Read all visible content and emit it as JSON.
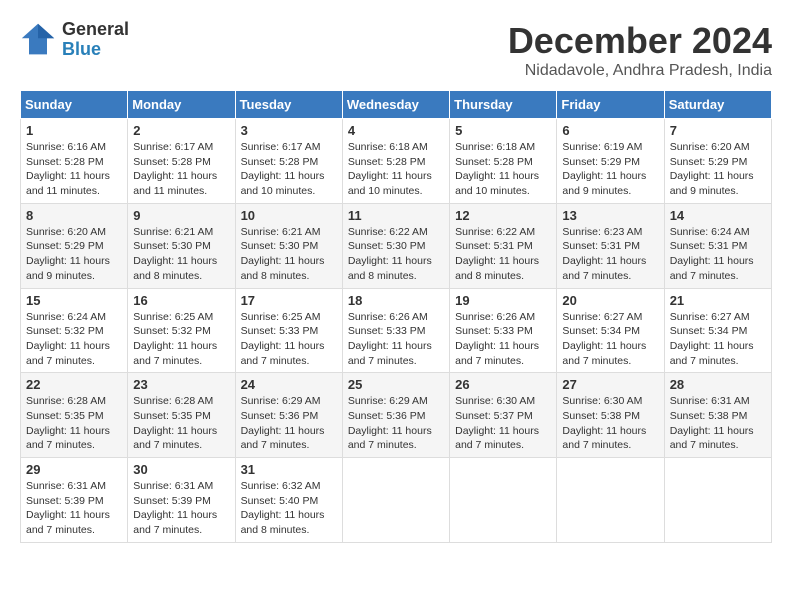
{
  "header": {
    "logo_general": "General",
    "logo_blue": "Blue",
    "month": "December 2024",
    "location": "Nidadavole, Andhra Pradesh, India"
  },
  "days_of_week": [
    "Sunday",
    "Monday",
    "Tuesday",
    "Wednesday",
    "Thursday",
    "Friday",
    "Saturday"
  ],
  "weeks": [
    [
      {
        "day": "1",
        "sunrise": "6:16 AM",
        "sunset": "5:28 PM",
        "daylight": "11 hours and 11 minutes."
      },
      {
        "day": "2",
        "sunrise": "6:17 AM",
        "sunset": "5:28 PM",
        "daylight": "11 hours and 11 minutes."
      },
      {
        "day": "3",
        "sunrise": "6:17 AM",
        "sunset": "5:28 PM",
        "daylight": "11 hours and 10 minutes."
      },
      {
        "day": "4",
        "sunrise": "6:18 AM",
        "sunset": "5:28 PM",
        "daylight": "11 hours and 10 minutes."
      },
      {
        "day": "5",
        "sunrise": "6:18 AM",
        "sunset": "5:28 PM",
        "daylight": "11 hours and 10 minutes."
      },
      {
        "day": "6",
        "sunrise": "6:19 AM",
        "sunset": "5:29 PM",
        "daylight": "11 hours and 9 minutes."
      },
      {
        "day": "7",
        "sunrise": "6:20 AM",
        "sunset": "5:29 PM",
        "daylight": "11 hours and 9 minutes."
      }
    ],
    [
      {
        "day": "8",
        "sunrise": "6:20 AM",
        "sunset": "5:29 PM",
        "daylight": "11 hours and 9 minutes."
      },
      {
        "day": "9",
        "sunrise": "6:21 AM",
        "sunset": "5:30 PM",
        "daylight": "11 hours and 8 minutes."
      },
      {
        "day": "10",
        "sunrise": "6:21 AM",
        "sunset": "5:30 PM",
        "daylight": "11 hours and 8 minutes."
      },
      {
        "day": "11",
        "sunrise": "6:22 AM",
        "sunset": "5:30 PM",
        "daylight": "11 hours and 8 minutes."
      },
      {
        "day": "12",
        "sunrise": "6:22 AM",
        "sunset": "5:31 PM",
        "daylight": "11 hours and 8 minutes."
      },
      {
        "day": "13",
        "sunrise": "6:23 AM",
        "sunset": "5:31 PM",
        "daylight": "11 hours and 7 minutes."
      },
      {
        "day": "14",
        "sunrise": "6:24 AM",
        "sunset": "5:31 PM",
        "daylight": "11 hours and 7 minutes."
      }
    ],
    [
      {
        "day": "15",
        "sunrise": "6:24 AM",
        "sunset": "5:32 PM",
        "daylight": "11 hours and 7 minutes."
      },
      {
        "day": "16",
        "sunrise": "6:25 AM",
        "sunset": "5:32 PM",
        "daylight": "11 hours and 7 minutes."
      },
      {
        "day": "17",
        "sunrise": "6:25 AM",
        "sunset": "5:33 PM",
        "daylight": "11 hours and 7 minutes."
      },
      {
        "day": "18",
        "sunrise": "6:26 AM",
        "sunset": "5:33 PM",
        "daylight": "11 hours and 7 minutes."
      },
      {
        "day": "19",
        "sunrise": "6:26 AM",
        "sunset": "5:33 PM",
        "daylight": "11 hours and 7 minutes."
      },
      {
        "day": "20",
        "sunrise": "6:27 AM",
        "sunset": "5:34 PM",
        "daylight": "11 hours and 7 minutes."
      },
      {
        "day": "21",
        "sunrise": "6:27 AM",
        "sunset": "5:34 PM",
        "daylight": "11 hours and 7 minutes."
      }
    ],
    [
      {
        "day": "22",
        "sunrise": "6:28 AM",
        "sunset": "5:35 PM",
        "daylight": "11 hours and 7 minutes."
      },
      {
        "day": "23",
        "sunrise": "6:28 AM",
        "sunset": "5:35 PM",
        "daylight": "11 hours and 7 minutes."
      },
      {
        "day": "24",
        "sunrise": "6:29 AM",
        "sunset": "5:36 PM",
        "daylight": "11 hours and 7 minutes."
      },
      {
        "day": "25",
        "sunrise": "6:29 AM",
        "sunset": "5:36 PM",
        "daylight": "11 hours and 7 minutes."
      },
      {
        "day": "26",
        "sunrise": "6:30 AM",
        "sunset": "5:37 PM",
        "daylight": "11 hours and 7 minutes."
      },
      {
        "day": "27",
        "sunrise": "6:30 AM",
        "sunset": "5:38 PM",
        "daylight": "11 hours and 7 minutes."
      },
      {
        "day": "28",
        "sunrise": "6:31 AM",
        "sunset": "5:38 PM",
        "daylight": "11 hours and 7 minutes."
      }
    ],
    [
      {
        "day": "29",
        "sunrise": "6:31 AM",
        "sunset": "5:39 PM",
        "daylight": "11 hours and 7 minutes."
      },
      {
        "day": "30",
        "sunrise": "6:31 AM",
        "sunset": "5:39 PM",
        "daylight": "11 hours and 7 minutes."
      },
      {
        "day": "31",
        "sunrise": "6:32 AM",
        "sunset": "5:40 PM",
        "daylight": "11 hours and 8 minutes."
      },
      null,
      null,
      null,
      null
    ]
  ]
}
